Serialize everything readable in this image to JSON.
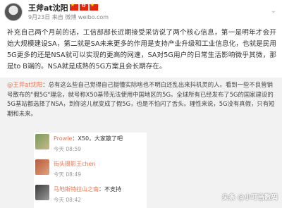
{
  "post": {
    "author": "王斧at沈阳",
    "meta": "9月23日 来自 微博 weibo.com",
    "body": "补充自己两个月前的话，工信部部长近期接受采访说了两个核心信息，第一是明年才会开始大规模建设SA，第二就是SA未来更多的作用是支持产业升级和工业信息化，也就是民用5G更多的还是NSA就可以实现的更高的网速，SA对5G用户的日常生活影响微乎其微，那是to B端的。NSA就是成熟的5G方案且会长期存在。"
  },
  "repost": {
    "mention": "@王斧at沈阳",
    "text_before": "：",
    "text": "总有这么些自己觉得自己挺懂实际啥也不明白还乱出来抖机灵的人。看到一些不良营销号散布的\"假5G\"理念，就号称X50基带无法使用中国地区的5G。全球所有已经发布了5G的国家建设的5G基站都选择了NSA，到你这儿就变成了假5G，也是不怕闪了舌头。理性来说，5G没有真假，只有短期和未来。"
  },
  "comments": [
    {
      "name": "Prowle",
      "text": "：X50，大家散了吧",
      "time": "今天 08:59"
    },
    {
      "name": "街头摄影王chen",
      "text": "",
      "time": "今天 08:49"
    },
    {
      "name": "马地斯特拉山之南",
      "text": "：不支持",
      "time": "今天 08:42"
    }
  ],
  "watermark": "头条 @小叮当数码",
  "colors": {
    "link_orange": "#eb7350",
    "repost_bg": "#f2f2f2"
  }
}
